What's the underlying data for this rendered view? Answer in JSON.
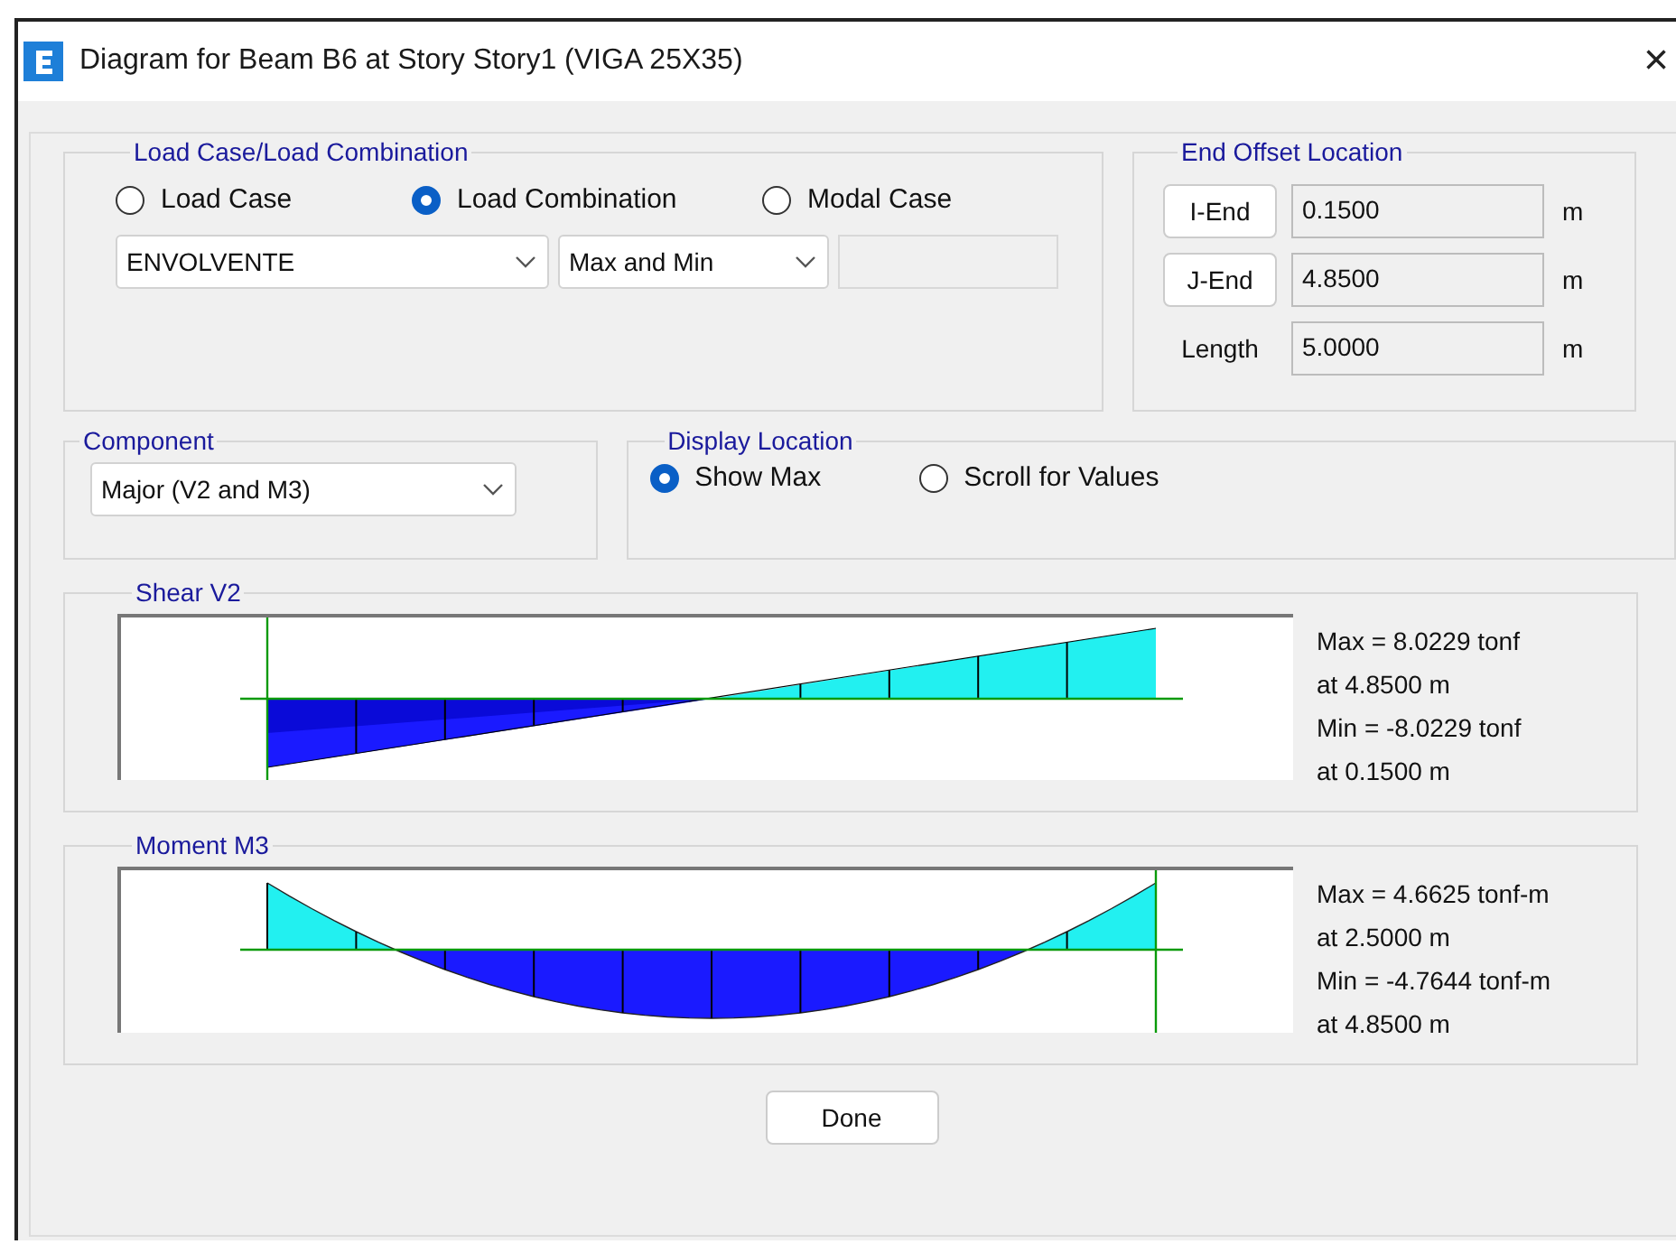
{
  "window": {
    "title": "Diagram for Beam B6 at Story Story1 (VIGA 25X35)",
    "close": "×"
  },
  "load_case": {
    "title": "Load Case/Load Combination",
    "options": [
      {
        "label": "Load Case",
        "selected": false
      },
      {
        "label": "Load Combination",
        "selected": true
      },
      {
        "label": "Modal Case",
        "selected": false
      }
    ],
    "combination": "ENVOLVENTE",
    "type": "Max and Min"
  },
  "end_offset": {
    "title": "End Offset Location",
    "rows": [
      {
        "kind": "button",
        "label": "I-End",
        "value": "0.1500",
        "unit": "m"
      },
      {
        "kind": "button",
        "label": "J-End",
        "value": "4.8500",
        "unit": "m"
      },
      {
        "kind": "label",
        "label": "Length",
        "value": "5.0000",
        "unit": "m"
      }
    ]
  },
  "component": {
    "title": "Component",
    "value": "Major (V2 and M3)"
  },
  "display_location": {
    "title": "Display Location",
    "options": [
      {
        "label": "Show Max",
        "selected": true
      },
      {
        "label": "Scroll for Values",
        "selected": false
      }
    ]
  },
  "diagrams": [
    {
      "kind": "shear",
      "title": "Shear V2",
      "lines": [
        "Max = 8.0229 tonf",
        "at 4.8500 m",
        "Min = -8.0229 tonf",
        "at 0.1500 m"
      ]
    },
    {
      "kind": "moment",
      "title": "Moment M3",
      "lines": [
        "Max = 4.6625 tonf-m",
        "at 2.5000 m",
        "Min = -4.7644 tonf-m",
        "at 4.8500 m"
      ]
    }
  ],
  "buttons": [
    "Done"
  ]
}
